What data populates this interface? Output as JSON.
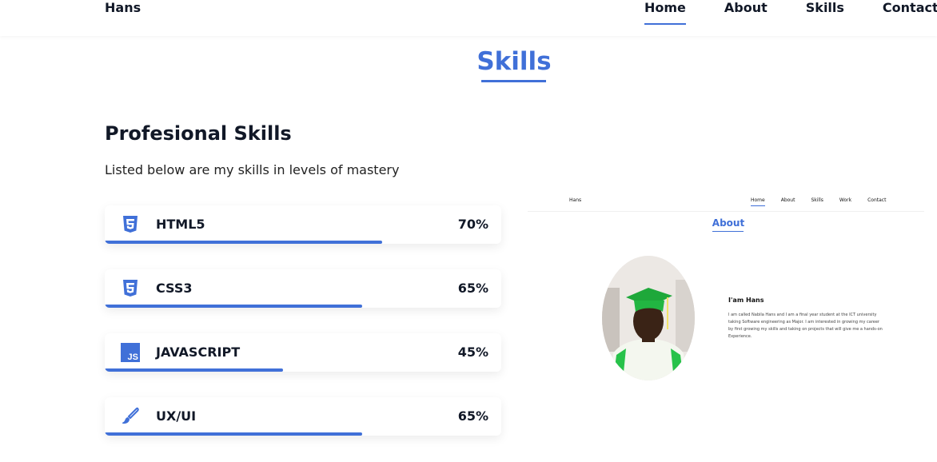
{
  "header": {
    "brand": "Hans",
    "nav": [
      "Home",
      "About",
      "Skills",
      "Contact"
    ],
    "active": "Home"
  },
  "section": {
    "title": "Skills",
    "heading": "Profesional Skills",
    "subtitle": "Listed below are my skills in levels of mastery"
  },
  "skills": [
    {
      "name": "HTML5",
      "percent_label": "70%",
      "level": 0.7,
      "icon": "html5-icon"
    },
    {
      "name": "CSS3",
      "percent_label": "65%",
      "level": 0.65,
      "icon": "css3-icon"
    },
    {
      "name": "JAVASCRIPT",
      "percent_label": "45%",
      "level": 0.45,
      "icon": "javascript-icon"
    },
    {
      "name": "UX/UI",
      "percent_label": "65%",
      "level": 0.65,
      "icon": "paintbrush-icon"
    }
  ],
  "preview": {
    "brand": "Hans",
    "nav": [
      "Home",
      "About",
      "Skills",
      "Work",
      "Contact"
    ],
    "title": "About",
    "greeting": "I'am Hans",
    "bio": "I am called Nabila Hans and I am a final year student at the ICT university taking Software engineering as Major. I am interested in growing my career by first growing my skills and taking on projects that will give me a hands-on Experience."
  },
  "colors": {
    "accent": "#4070d8",
    "text": "#111827"
  }
}
